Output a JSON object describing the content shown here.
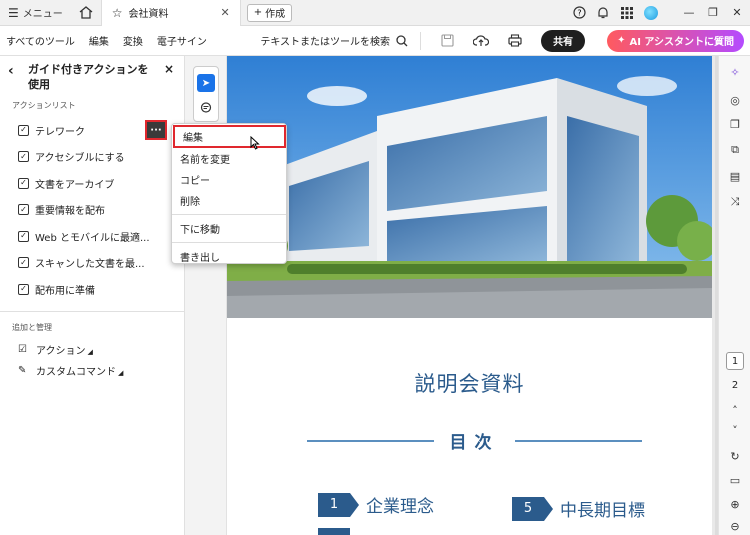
{
  "tabbar": {
    "menu_label": "メニュー",
    "doc_tab_label": "会社資料",
    "new_tab_label": "作成"
  },
  "toolbar": {
    "menu_items": [
      "すべてのツール",
      "編集",
      "変換",
      "電子サイン"
    ],
    "search_label": "テキストまたはツールを検索",
    "share_label": "共有",
    "ai_label": "AI アシスタントに質問"
  },
  "leftpanel": {
    "title_line1": "ガイド付きアクションを",
    "title_line2": "使用",
    "section_actions": "アクションリスト",
    "actions": [
      {
        "label": "テレワーク"
      },
      {
        "label": "アクセシブルにする"
      },
      {
        "label": "文書をアーカイブ"
      },
      {
        "label": "重要情報を配布"
      },
      {
        "label": "Web とモバイルに最適..."
      },
      {
        "label": "スキャンした文書を最..."
      },
      {
        "label": "配布用に準備"
      }
    ],
    "section_manage": "追加と管理",
    "manage_items": [
      {
        "label": "アクション"
      },
      {
        "label": "カスタムコマンド"
      }
    ]
  },
  "context_menu": {
    "items": [
      "編集",
      "名前を変更",
      "コピー",
      "削除",
      "下に移動",
      "書き出し"
    ]
  },
  "document": {
    "title": "説明会資料",
    "toc_heading": "目次",
    "toc_items": [
      {
        "num": "1",
        "text": "企業理念"
      },
      {
        "num": "5",
        "text": "中長期目標"
      }
    ]
  },
  "pager": {
    "pages": [
      "1",
      "2"
    ]
  },
  "colors": {
    "accent": "#2b5b8c",
    "highlight": "#e0282e",
    "cursor_tool": "#1a73e8"
  }
}
